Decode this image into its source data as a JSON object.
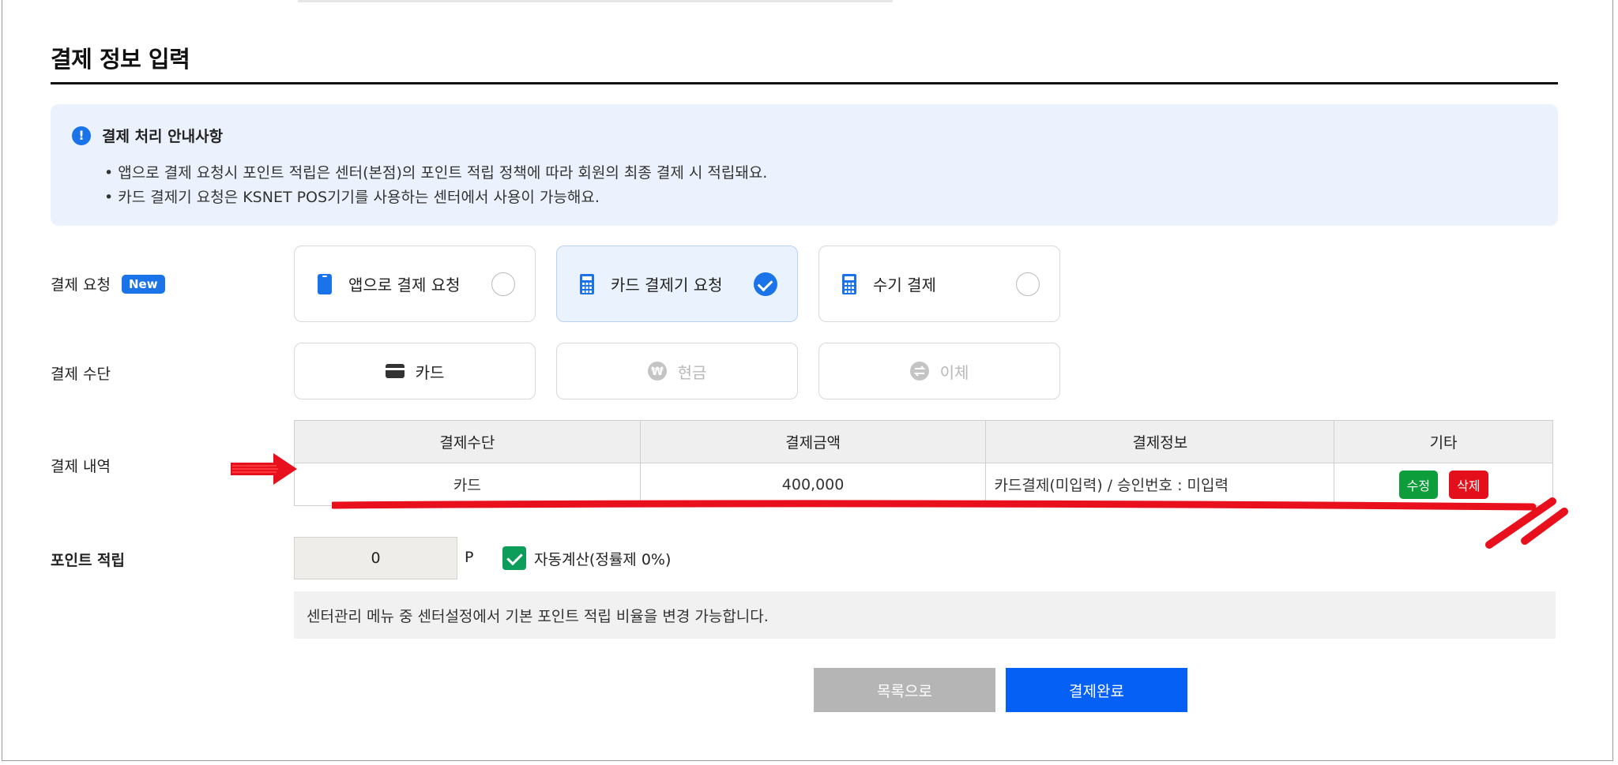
{
  "page": {
    "title": "결제 정보 입력"
  },
  "notice": {
    "title": "결제 처리 안내사항",
    "lines": [
      "앱으로 결제 요청시 포인트 적립은 센터(본점)의 포인트 적립 정책에 따라 회원의 최종 결제 시 적립돼요.",
      "카드 결제기 요청은 KSNET POS기기를 사용하는 센터에서 사용이 가능해요."
    ]
  },
  "request": {
    "label": "결제 요청",
    "badge": "New",
    "options": [
      {
        "label": "앱으로 결제 요청",
        "icon": "phone-icon",
        "selected": false
      },
      {
        "label": "카드 결제기 요청",
        "icon": "card-terminal-icon",
        "selected": true
      },
      {
        "label": "수기 결제",
        "icon": "calculator-icon",
        "selected": false
      }
    ]
  },
  "method": {
    "label": "결제 수단",
    "options": [
      {
        "label": "카드",
        "icon": "credit-card-icon",
        "enabled": true
      },
      {
        "label": "현금",
        "icon": "won-icon",
        "enabled": false
      },
      {
        "label": "이체",
        "icon": "transfer-icon",
        "enabled": false
      }
    ]
  },
  "history": {
    "label": "결제 내역",
    "columns": [
      "결제수단",
      "결제금액",
      "결제정보",
      "기타"
    ],
    "rows": [
      {
        "method": "카드",
        "amount": "400,000",
        "info": "카드결제(미입력) / 승인번호 : 미입력",
        "edit": "수정",
        "delete": "삭제"
      }
    ]
  },
  "points": {
    "label": "포인트 적립",
    "value": "0",
    "unit": "P",
    "auto_label": "자동계산(정률제 0%)",
    "auto_checked": true,
    "hint": "센터관리 메뉴 중 센터설정에서 기본 포인트 적립 비율을 변경 가능합니다."
  },
  "actions": {
    "back": "목록으로",
    "complete": "결제완료"
  },
  "colors": {
    "primary": "#1a73e8",
    "button_blue": "#0560f5",
    "success": "#0d9d3a",
    "danger": "#e3101c",
    "annotation": "#e8101c"
  }
}
